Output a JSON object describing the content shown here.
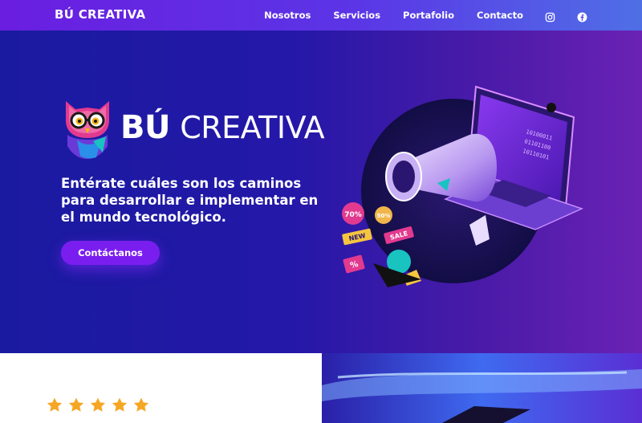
{
  "navbar": {
    "brand": "BÚ CREATIVA",
    "links": [
      {
        "label": "Nosotros"
      },
      {
        "label": "Servicios"
      },
      {
        "label": "Portafolio"
      },
      {
        "label": "Contacto"
      }
    ],
    "icons": [
      "instagram-icon",
      "facebook-icon"
    ]
  },
  "hero": {
    "logo_bold": "BÚ",
    "logo_light": "CREATIVA",
    "tagline": "Entérate cuáles son los caminos para desarrollar e implementar en el mundo tecnológico.",
    "cta_label": "Contáctanos",
    "illustration": {
      "tags": [
        "70%",
        "50%",
        "NEW",
        "SALE",
        "%"
      ],
      "binary": [
        "10100011",
        "01101100",
        "10110101"
      ]
    }
  },
  "rating": {
    "stars": 5,
    "max": 5
  },
  "colors": {
    "nav_start": "#6a1ee0",
    "nav_end": "#4f6fe6",
    "hero_start": "#1a1aa0",
    "hero_end": "#6a22b4",
    "cta": "#7a1ef0",
    "star": "#f5a623"
  }
}
